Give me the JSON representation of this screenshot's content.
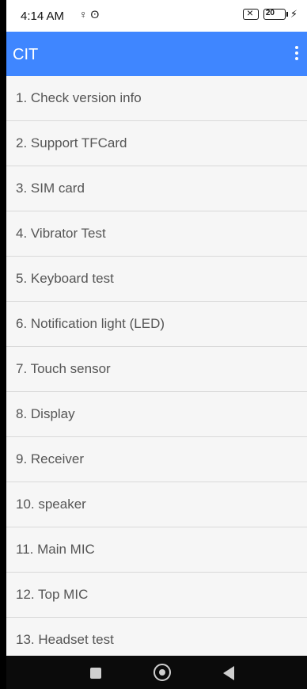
{
  "status": {
    "time": "4:14 AM",
    "left_icons": "♀ ʘ",
    "battery": "20"
  },
  "appbar": {
    "title": "CIT"
  },
  "items": [
    {
      "label": "1. Check version info"
    },
    {
      "label": "2. Support TFCard"
    },
    {
      "label": "3. SIM card"
    },
    {
      "label": "4. Vibrator Test"
    },
    {
      "label": "5. Keyboard test"
    },
    {
      "label": "6. Notification light (LED)"
    },
    {
      "label": "7. Touch sensor"
    },
    {
      "label": "8. Display"
    },
    {
      "label": "9. Receiver"
    },
    {
      "label": "10. speaker"
    },
    {
      "label": "11. Main MIC"
    },
    {
      "label": "12. Top MIC"
    },
    {
      "label": "13. Headset test"
    }
  ]
}
